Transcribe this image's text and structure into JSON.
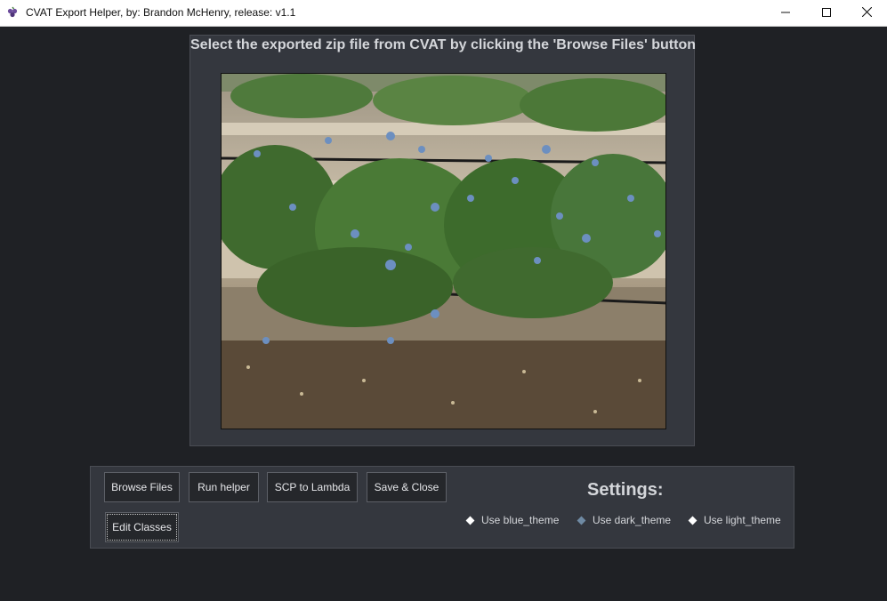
{
  "window": {
    "title": "CVAT Export Helper, by: Brandon McHenry, release: v1.1",
    "app_icon": "grape-icon",
    "controls": [
      "minimize-icon",
      "maximize-icon",
      "close-icon"
    ]
  },
  "main": {
    "instruction": "Select the exported zip file from CVAT by clicking the 'Browse Files' button",
    "preview_image": "blueberry-bush-photo"
  },
  "buttons": {
    "browse_files": "Browse Files",
    "run_helper": "Run helper",
    "scp_to_lambda": "SCP to Lambda",
    "save_close": "Save & Close",
    "edit_classes": "Edit Classes"
  },
  "settings": {
    "title": "Settings:",
    "themes": [
      {
        "label": "Use blue_theme",
        "selected": false
      },
      {
        "label": "Use dark_theme",
        "selected": true
      },
      {
        "label": "Use light_theme",
        "selected": false
      }
    ]
  },
  "colors": {
    "background": "#1f2125",
    "panel": "#34373e",
    "button": "#25272b",
    "text": "#d4d6da",
    "selected_radio": "#6f8aa3"
  }
}
